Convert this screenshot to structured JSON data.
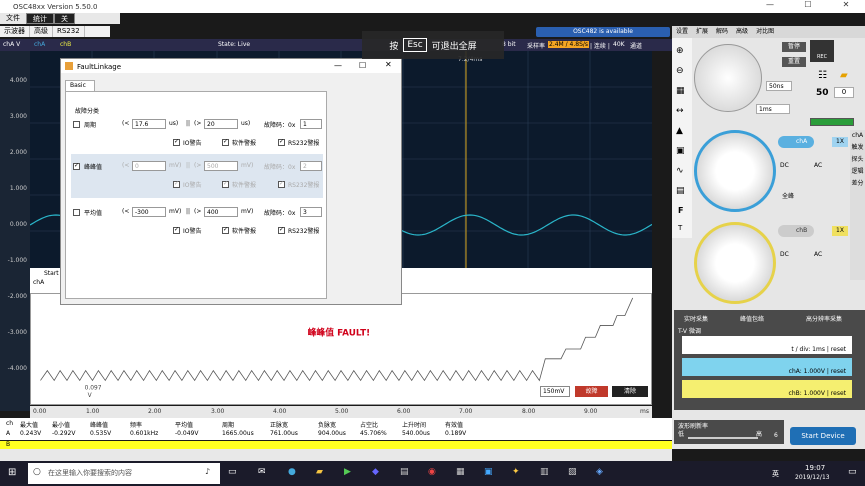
{
  "app": {
    "title": "OSC48xx  Version 5.50.0",
    "menu": [
      "文件",
      "统计",
      "关"
    ],
    "tabs": [
      "示波器",
      "高级",
      "RS232"
    ]
  },
  "toolbar": {
    "ch_label": "chA V",
    "chA": "chA",
    "chB": "chB",
    "state": "State: Live",
    "bit": "8 bit",
    "rate_label": "采样率",
    "rate": "2.4M / 4.8S/s",
    "mode": "| 连续 |",
    "depth": "40K",
    "channel": "通道",
    "available": "OSC482  is available"
  },
  "overlay": {
    "prefix": "按",
    "key": "Esc",
    "suffix": "可退出全屏"
  },
  "plot": {
    "ylabels": [
      "4.000",
      "3.000",
      "2.000",
      "1.000",
      "0.000",
      "-1.000",
      "-2.000",
      "-3.000",
      "-4.000"
    ],
    "xlabels": [
      "0.00",
      "1.00",
      "2.00",
      "3.00",
      "4.00",
      "5.00",
      "6.00",
      "7.00",
      "8.00",
      "9.00"
    ],
    "xunit": "ms",
    "marker": "7.2/4ms",
    "cursor_val": "0.097",
    "cursor_unit": "V",
    "start": "Start",
    "cha2": "chA",
    "fault_text": "峰峰值 FAULT!",
    "range": "150mV",
    "btn_fault": "故障",
    "btn_clear": "清除",
    "trace_color": "#2ab5c9"
  },
  "meas": {
    "headers": [
      "ch",
      "最大值",
      "最小值",
      "峰峰值",
      "频率",
      "平均值",
      "周期",
      "正脉宽",
      "负脉宽",
      "占空比",
      "上升时间",
      "有效值"
    ],
    "rowA": [
      "A",
      "0.243V",
      "-0.292V",
      "0.535V",
      "0.601kHz",
      "-0.049V",
      "1665.00us",
      "761.00us",
      "904.00us",
      "45.706%",
      "540.00us",
      "0.189V"
    ],
    "rowB": [
      "B"
    ]
  },
  "dialog": {
    "title": "FaultLinkage",
    "tab": "Basic",
    "group": "故障分类",
    "rows": [
      {
        "name": "周期",
        "lt": "(<",
        "v1": "17.6",
        "u1": "us)",
        "or": "||",
        "gt": "(>",
        "v2": "20",
        "u2": "us)",
        "code_l": "故障码：0x",
        "code": "1",
        "io": "IO警告",
        "sw": "软件警报",
        "rs": "RS232警报"
      },
      {
        "name": "峰峰值",
        "lt": "(<",
        "v1": "0",
        "u1": "mV)",
        "or": "||",
        "gt": "(>",
        "v2": "500",
        "u2": "mV)",
        "code_l": "故障码：0x",
        "code": "2",
        "io": "IO警告",
        "sw": "软件警报",
        "rs": "RS232警报"
      },
      {
        "name": "平均值",
        "lt": "(<",
        "v1": "-300",
        "u1": "mV)",
        "or": "||",
        "gt": "(>",
        "v2": "400",
        "u2": "mV)",
        "code_l": "故障码：0x",
        "code": "3",
        "io": "IO警告",
        "sw": "软件警报",
        "rs": "RS232警报"
      }
    ]
  },
  "right": {
    "tabs": [
      "设置",
      "扩展",
      "解码",
      "高级",
      "对比图"
    ],
    "rec": "REC",
    "timebase": "50ns",
    "tb2": "1ms",
    "ctr": "50",
    "ctr2": "0",
    "pause": "暂停",
    "reset": "重置",
    "chA": "chA",
    "chB": "chB",
    "x1": "1X",
    "dc": "DC",
    "ac": "AC",
    "all": "全峰",
    "side": [
      "chA",
      "触发",
      "探头",
      "逻辑",
      "差分"
    ],
    "modes": [
      "实时采集",
      "峰值包络",
      "高分辨率采集"
    ],
    "tv": "T-V 微调",
    "tdiv": "t / div: 1ms | reset",
    "chAv": "chA: 1.000V | reset",
    "chBv": "chB: 1.000V | reset",
    "refresh": "波形刷新率",
    "low": "低",
    "high": "高",
    "refval": "6",
    "start": "Start Device"
  },
  "taskbar": {
    "search": "在这里输入你要搜索的内容",
    "time": "19:07",
    "date": "2019/12/13",
    "lang": "英"
  }
}
